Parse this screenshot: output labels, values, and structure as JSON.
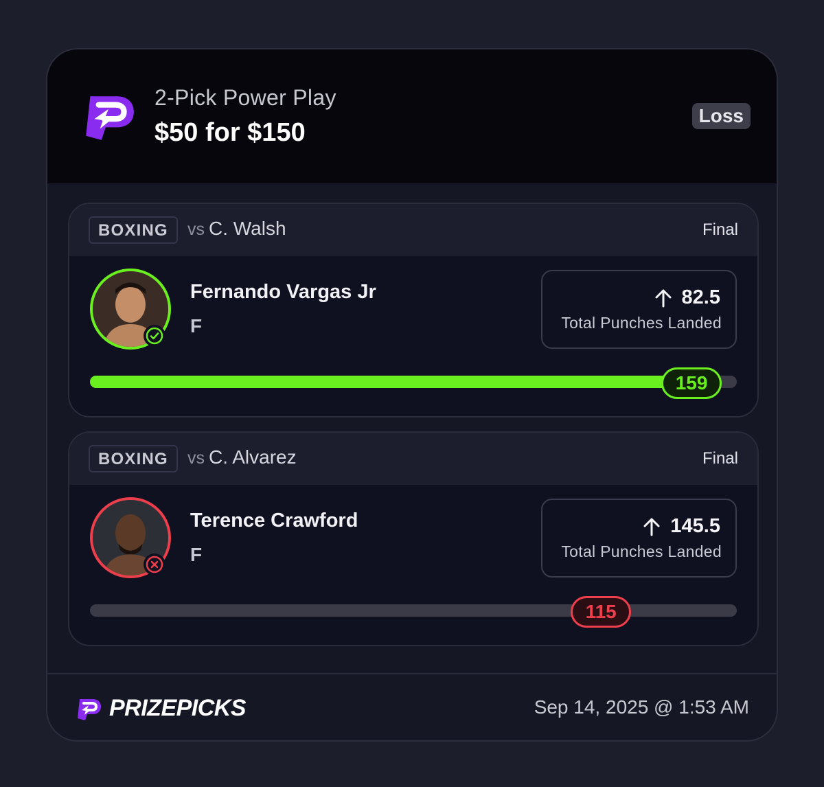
{
  "header": {
    "play_type": "2-Pick Power Play",
    "payout": "$50 for $150",
    "result": "Loss",
    "brand_color": "#8a2cf0"
  },
  "picks": [
    {
      "sport": "BOXING",
      "vs_prefix": "vs",
      "opponent": "C. Walsh",
      "status": "Final",
      "player": "Fernando Vargas Jr",
      "position": "F",
      "direction_icon": "arrow-up-icon",
      "line": "82.5",
      "stat": "Total Punches Landed",
      "actual": "159",
      "progress": 0.93,
      "outcome": "hit",
      "color": "#6bf01f"
    },
    {
      "sport": "BOXING",
      "vs_prefix": "vs",
      "opponent": "C. Alvarez",
      "status": "Final",
      "player": "Terence Crawford",
      "position": "F",
      "direction_icon": "arrow-up-icon",
      "line": "145.5",
      "stat": "Total Punches Landed",
      "actual": "115",
      "progress": 0.79,
      "outcome": "miss",
      "color": "#ec3e4b"
    }
  ],
  "footer": {
    "brand": "PRIZEPICKS",
    "timestamp": "Sep 14, 2025 @ 1:53 AM"
  }
}
